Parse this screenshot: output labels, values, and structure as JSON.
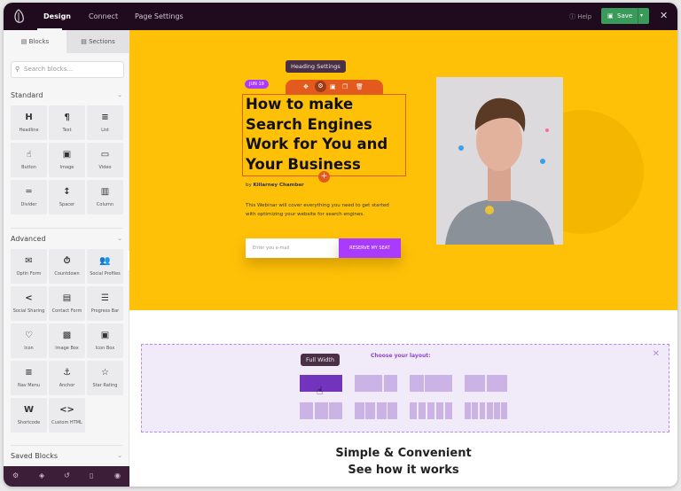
{
  "topbar": {
    "nav": [
      "Design",
      "Connect",
      "Page Settings"
    ],
    "help": "Help",
    "save": "Save"
  },
  "sidebar": {
    "tabs": [
      "Blocks",
      "Sections"
    ],
    "search_placeholder": "Search blocks...",
    "standard_title": "Standard",
    "standard": [
      {
        "icon": "H",
        "label": "Headline",
        "name": "headline"
      },
      {
        "icon": "¶",
        "label": "Text",
        "name": "text"
      },
      {
        "icon": "≡",
        "label": "List",
        "name": "list"
      },
      {
        "icon": "☝",
        "label": "Button",
        "name": "button"
      },
      {
        "icon": "▣",
        "label": "Image",
        "name": "image"
      },
      {
        "icon": "▭",
        "label": "Video",
        "name": "video"
      },
      {
        "icon": "═",
        "label": "Divider",
        "name": "divider"
      },
      {
        "icon": "↕",
        "label": "Spacer",
        "name": "spacer"
      },
      {
        "icon": "▥",
        "label": "Column",
        "name": "column"
      }
    ],
    "advanced_title": "Advanced",
    "advanced": [
      {
        "icon": "✉",
        "label": "Optin Form",
        "name": "optin-form"
      },
      {
        "icon": "⏱",
        "label": "Countdown",
        "name": "countdown"
      },
      {
        "icon": "👥",
        "label": "Social Profiles",
        "name": "social-profiles"
      },
      {
        "icon": "<",
        "label": "Social Sharing",
        "name": "social-sharing"
      },
      {
        "icon": "▤",
        "label": "Contact Form",
        "name": "contact-form"
      },
      {
        "icon": "☰",
        "label": "Progress Bar",
        "name": "progress-bar"
      },
      {
        "icon": "♡",
        "label": "Icon",
        "name": "icon"
      },
      {
        "icon": "▩",
        "label": "Image Box",
        "name": "image-box"
      },
      {
        "icon": "▣",
        "label": "Icon Box",
        "name": "icon-box"
      },
      {
        "icon": "≡",
        "label": "Nav Menu",
        "name": "nav-menu"
      },
      {
        "icon": "⚓",
        "label": "Anchor",
        "name": "anchor"
      },
      {
        "icon": "☆",
        "label": "Star Rating",
        "name": "star-rating"
      },
      {
        "icon": "W",
        "label": "Shortcode",
        "name": "shortcode"
      },
      {
        "icon": "<>",
        "label": "Custom HTML",
        "name": "custom-html"
      }
    ],
    "saved_title": "Saved Blocks",
    "bottom_icons": [
      "gear-icon",
      "layers-icon",
      "history-icon",
      "mobile-icon",
      "eye-icon"
    ]
  },
  "hero": {
    "tooltip": "Heading Settings",
    "date_badge": "JUN 19",
    "heading": "How to make Search Engines Work for You and Your Business",
    "by_prefix": "by",
    "author": "Killarney Chamber",
    "description": "This Webinar will cover everything you need to get started with optimizing your website for search engines.",
    "email_placeholder": "Enter you e-mail",
    "cta": "RESERVE MY SEAT"
  },
  "layout_chooser": {
    "title": "Choose your layout:",
    "tooltip": "Full Width",
    "selected": "Full Width",
    "options": [
      [
        1
      ],
      [
        2,
        1
      ],
      [
        1,
        2
      ],
      [
        1,
        1
      ],
      [
        1,
        1,
        1
      ],
      [
        1,
        1,
        1,
        1
      ],
      [
        1,
        1,
        1,
        1,
        1
      ],
      [
        1,
        1,
        1,
        1,
        1,
        1
      ]
    ]
  },
  "footer": {
    "line1": "Simple & Convenient",
    "line2": "See how it works"
  },
  "colors": {
    "topbar": "#200a1e",
    "hero": "#ffc107",
    "accent": "#a93bff",
    "selection": "#e35a1f",
    "save": "#3a9a5a"
  }
}
